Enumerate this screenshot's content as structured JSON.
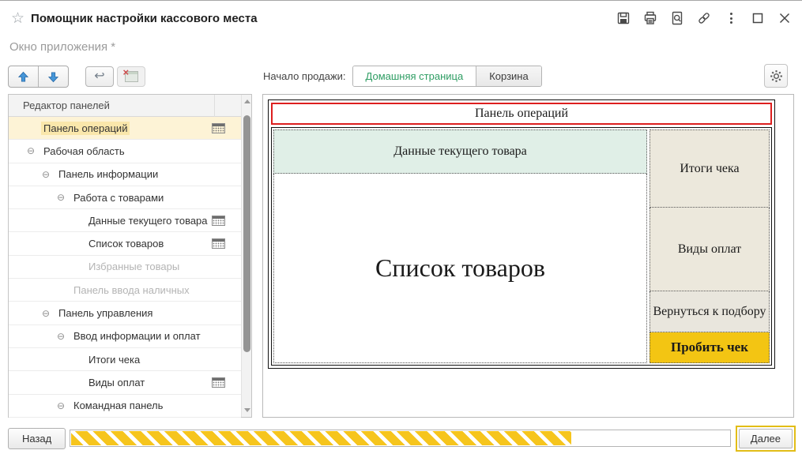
{
  "window": {
    "title": "Помощник настройки кассового места",
    "subtitle": "Окно приложения *"
  },
  "titlebar": {
    "icons": [
      "favorite-star-icon",
      "save-icon",
      "print-icon",
      "print-preview-icon",
      "link-icon",
      "more-menu-icon",
      "maximize-icon",
      "close-icon"
    ]
  },
  "toolbar": {
    "sale_start_label": "Начало продажи:",
    "segments": [
      {
        "label": "Домашняя страница",
        "selected": true
      },
      {
        "label": "Корзина",
        "selected": false
      }
    ]
  },
  "tree": {
    "header": "Редактор панелей",
    "items": [
      {
        "label": "Панель операций",
        "level": 0,
        "expand": false,
        "grid_icon": true,
        "selected": true,
        "disabled": false
      },
      {
        "label": "Рабочая область",
        "level": 0,
        "expand": true,
        "grid_icon": false,
        "selected": false,
        "disabled": false
      },
      {
        "label": "Панель информации",
        "level": 1,
        "expand": true,
        "grid_icon": false,
        "selected": false,
        "disabled": false
      },
      {
        "label": "Работа с товарами",
        "level": 2,
        "expand": true,
        "grid_icon": false,
        "selected": false,
        "disabled": false
      },
      {
        "label": "Данные текущего товара",
        "level": 3,
        "expand": false,
        "grid_icon": true,
        "selected": false,
        "disabled": false
      },
      {
        "label": "Список товаров",
        "level": 3,
        "expand": false,
        "grid_icon": true,
        "selected": false,
        "disabled": false
      },
      {
        "label": "Избранные товары",
        "level": 3,
        "expand": false,
        "grid_icon": false,
        "selected": false,
        "disabled": true
      },
      {
        "label": "Панель ввода наличных",
        "level": 2,
        "expand": false,
        "grid_icon": false,
        "selected": false,
        "disabled": true
      },
      {
        "label": "Панель управления",
        "level": 1,
        "expand": true,
        "grid_icon": false,
        "selected": false,
        "disabled": false
      },
      {
        "label": "Ввод информации и оплат",
        "level": 2,
        "expand": true,
        "grid_icon": false,
        "selected": false,
        "disabled": false
      },
      {
        "label": "Итоги чека",
        "level": 3,
        "expand": false,
        "grid_icon": false,
        "selected": false,
        "disabled": false
      },
      {
        "label": "Виды оплат",
        "level": 3,
        "expand": false,
        "grid_icon": true,
        "selected": false,
        "disabled": false
      },
      {
        "label": "Командная панель",
        "level": 2,
        "expand": true,
        "grid_icon": false,
        "selected": false,
        "disabled": false
      }
    ]
  },
  "preview": {
    "operations_panel": "Панель операций",
    "current_item_panel": "Данные текущего товара",
    "items_list_panel": "Список товаров",
    "receipt_totals_panel": "Итоги чека",
    "payment_types_panel": "Виды оплат",
    "back_to_selection_button": "Вернуться к подбору",
    "commit_receipt_button": "Пробить чек"
  },
  "footer": {
    "back_label": "Назад",
    "next_label": "Далее",
    "progress_percent": 76
  },
  "icons": {
    "star": "☆",
    "collapse": "⊖",
    "undo": "↩"
  },
  "colors": {
    "accent_green": "#2e9d63",
    "selection_yellow": "#fdf3d6",
    "selection_yellow_strong": "#fae7ab",
    "mockup_red": "#dd1f1f",
    "mockup_mint": "#e0efe7",
    "mockup_beige": "#ece8dc",
    "mockup_beige2": "#e9e6dd",
    "mockup_gold": "#f3c513",
    "progress_yellow": "#f6c51d",
    "next_button_ring": "#e2bd17",
    "arrow_blue": "#4596d8"
  }
}
